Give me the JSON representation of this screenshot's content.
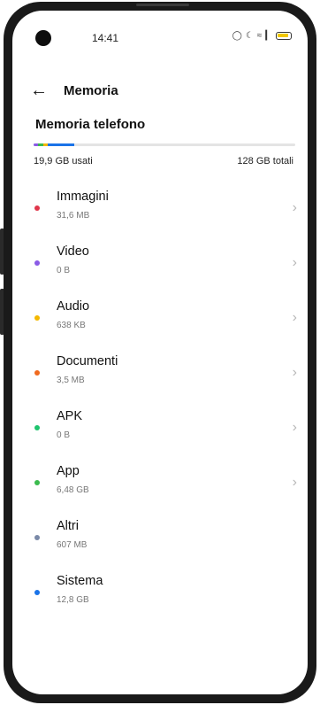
{
  "status": {
    "time": "14:41",
    "icons": [
      "alarm-icon",
      "moon-icon",
      "wifi-icon",
      "signal-icon",
      "battery-icon"
    ]
  },
  "header": {
    "title": "Memoria",
    "back_icon": "arrow-left-icon"
  },
  "section": {
    "title": "Memoria telefono"
  },
  "usage": {
    "used_label": "19,9  GB usati",
    "total_label": "128 GB totali",
    "used_fraction": 0.155
  },
  "items": [
    {
      "label": "Immagini",
      "size": "31,6 MB",
      "color": "#e0364b",
      "chevron": true
    },
    {
      "label": "Video",
      "size": "0 B",
      "color": "#8a5be6",
      "chevron": true
    },
    {
      "label": "Audio",
      "size": "638 KB",
      "color": "#f4b800",
      "chevron": true
    },
    {
      "label": "Documenti",
      "size": "3,5 MB",
      "color": "#f06a1f",
      "chevron": true
    },
    {
      "label": "APK",
      "size": "0 B",
      "color": "#1fc46e",
      "chevron": true
    },
    {
      "label": "App",
      "size": "6,48  GB",
      "color": "#3bbb4e",
      "chevron": true
    },
    {
      "label": "Altri",
      "size": "607 MB",
      "color": "#7a8aa8",
      "chevron": false
    },
    {
      "label": "Sistema",
      "size": "12,8 GB",
      "color": "#1a73e8",
      "chevron": false
    }
  ],
  "bar_colors": [
    "#8a5be6",
    "#3bbb4e",
    "#f4b800",
    "#1a73e8"
  ]
}
